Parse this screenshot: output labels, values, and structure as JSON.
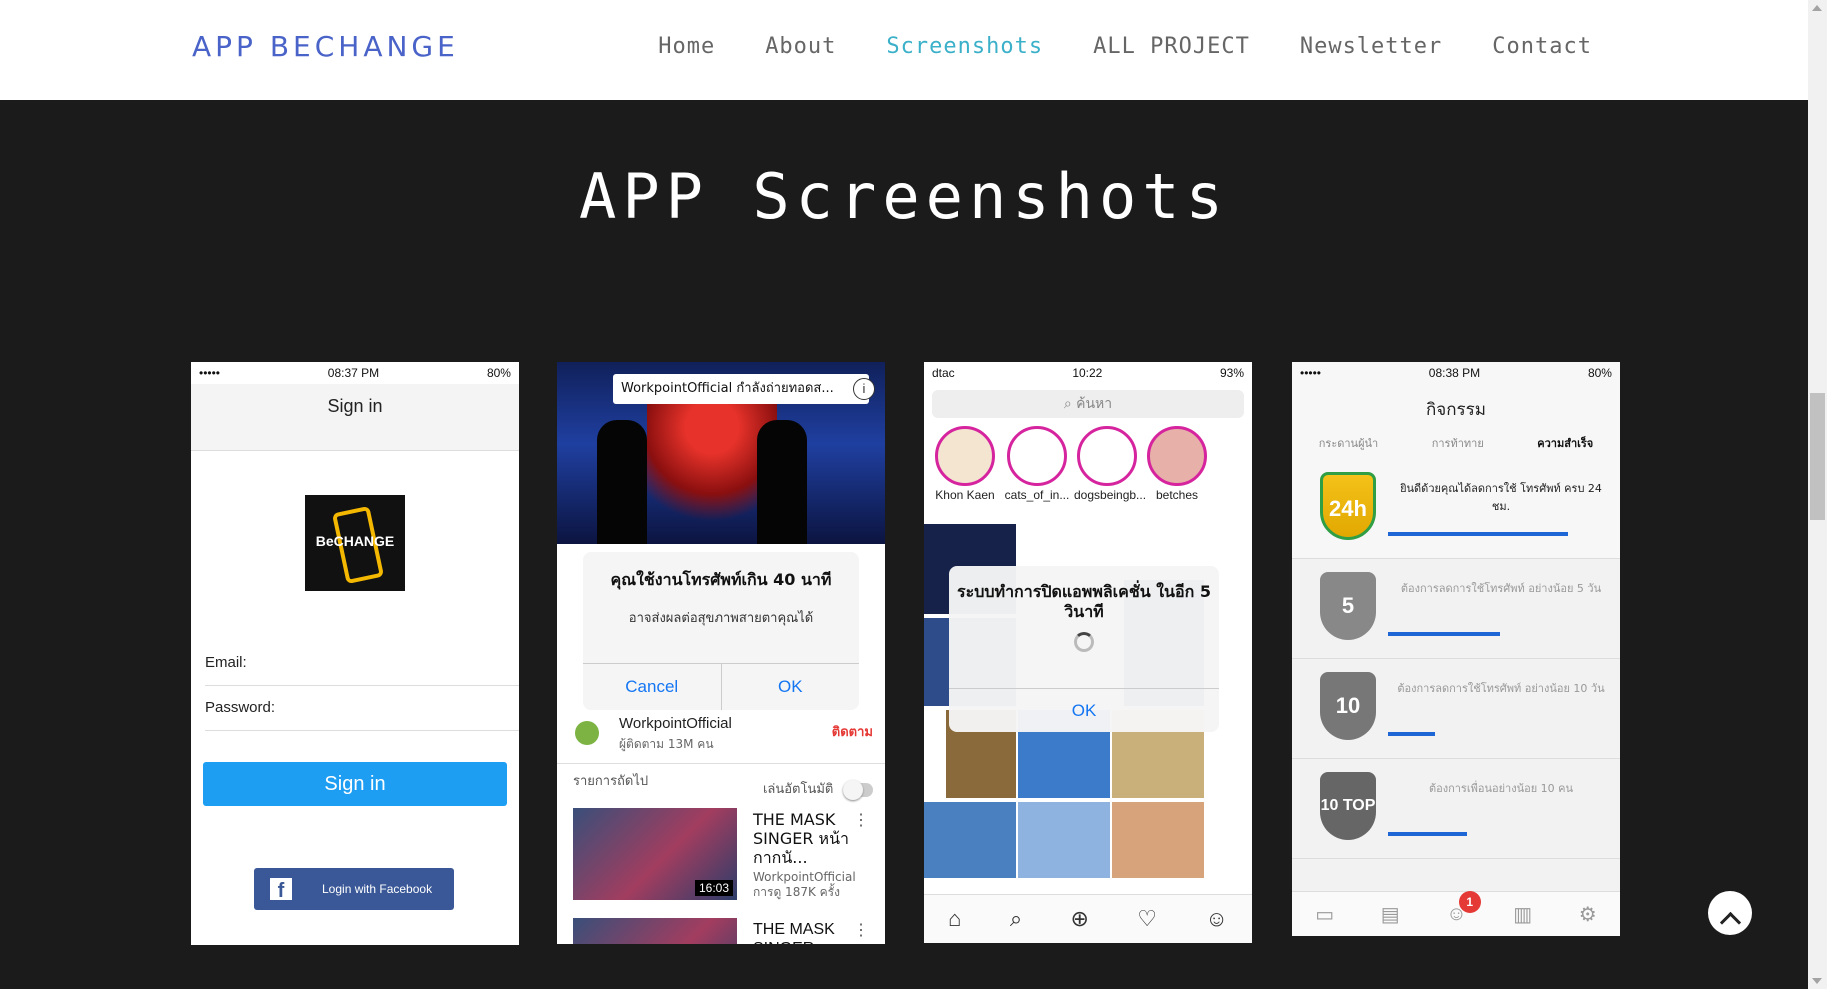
{
  "header": {
    "brand": "APP BECHANGE",
    "nav": [
      "Home",
      "About",
      "Screenshots",
      "ALL PROJECT",
      "Newsletter",
      "Contact"
    ],
    "active_nav": "Screenshots"
  },
  "section": {
    "title": "APP Screenshots"
  },
  "phone1": {
    "status": {
      "signal": "•••••",
      "time": "08:37 PM",
      "battery": "80%"
    },
    "nav_title": "Sign in",
    "logo_text": "BeCHANGE",
    "email_label": "Email:",
    "password_label": "Password:",
    "signin_label": "Sign in",
    "facebook_label": "Login with Facebook"
  },
  "phone2": {
    "banner": "WorkpointOfficial กำลังถ่ายทอดส...",
    "dialog_title": "คุณใช้งานโทรศัพท์เกิน 40 นาที",
    "dialog_message": "อาจส่งผลต่อสุขภาพสายตาคุณได้",
    "cancel_label": "Cancel",
    "ok_label": "OK",
    "channel_name": "WorkpointOfficial",
    "channel_subs": "ผู้ติดตาม 13M คน",
    "subscribe_label": "ติดตาม",
    "up_next": "รายการถัดไป",
    "autoplay": "เล่นอัตโนมัติ",
    "videos": [
      {
        "title": "THE MASK SINGER หน้ากากนั...",
        "duration": "16:03",
        "channel": "WorkpointOfficial",
        "views": "การดู 187K ครั้ง"
      },
      {
        "title": "THE MASK SINGER",
        "duration": "",
        "channel": "",
        "views": ""
      }
    ]
  },
  "phone3": {
    "status": {
      "carrier": "dtac",
      "time": "10:22",
      "battery": "93%"
    },
    "search_placeholder": "ค้นหา",
    "stories": [
      "Khon Kaen",
      "cats_of_in...",
      "dogsbeingb...",
      "betches"
    ],
    "dialog_title": "ระบบทำการปิดแอพพลิเคชั่น ในอีก 5 วินาที",
    "ok_label": "OK"
  },
  "phone4": {
    "status": {
      "signal": "•••••",
      "time": "08:38 PM",
      "battery": "80%"
    },
    "title": "กิจกรรม",
    "tabs": [
      "กระดานผู้นำ",
      "การท้าทาย",
      "ความสำเร็จ"
    ],
    "selected_tab": "ความสำเร็จ",
    "achievements": [
      {
        "badge": "24h",
        "text": "ยินดีด้วยคุณได้ลดการใช้ โทรศัพท์ ครบ 24 ชม.",
        "progress": 1.0
      },
      {
        "badge": "5",
        "text": "ต้องการลดการใช้โทรศัพท์ อย่างน้อย 5 วัน",
        "progress": 0.62
      },
      {
        "badge": "10",
        "text": "ต้องการลดการใช้โทรศัพท์ อย่างน้อย 10 วัน",
        "progress": 0.26
      },
      {
        "badge": "10 TOP",
        "text": "ต้องการเพื่อนอย่างน้อย 10 คน",
        "progress": 0.44
      }
    ],
    "notification_count": "1"
  },
  "colors": {
    "brand": "#4a63c9",
    "active_nav": "#3bb0c9",
    "signin": "#1e9ef3",
    "facebook": "#3a5897"
  }
}
